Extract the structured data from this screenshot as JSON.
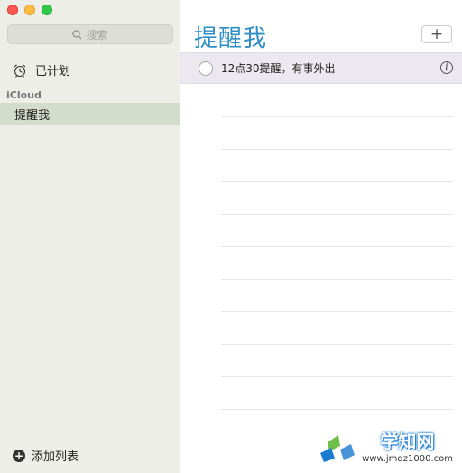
{
  "sidebar": {
    "search_placeholder": "搜索",
    "scheduled_label": "已计划",
    "group_label": "iCloud",
    "lists": [
      {
        "label": "提醒我",
        "selected": true
      }
    ],
    "add_list_label": "添加列表"
  },
  "main": {
    "title": "提醒我",
    "add_button": "+",
    "reminders": [
      {
        "text": "12点30提醒，有事外出"
      }
    ],
    "info_icon": "i"
  },
  "watermark": {
    "title": "学知网",
    "url": "www.jmqz1000.com"
  },
  "colors": {
    "title": "#2f8ec5",
    "sidebar_bg": "#eceee7",
    "selected_list_bg": "#d4dccb",
    "reminder_row_bg": "#ebe9ef"
  }
}
